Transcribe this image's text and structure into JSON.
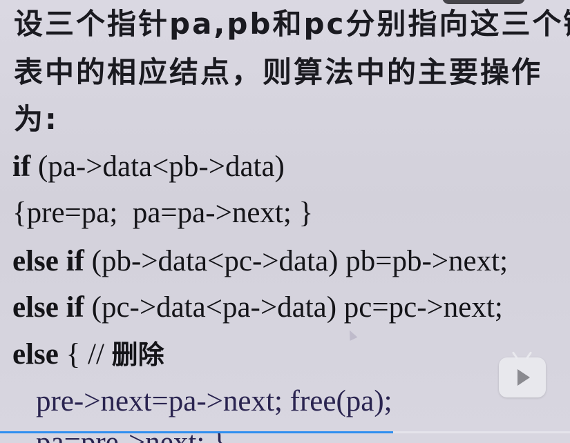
{
  "slide": {
    "intro_lines": [
      "设三个指针pa,pb和pc分别指向这三个链",
      "表中的相应结点，则算法中的主要操作",
      "为:"
    ],
    "code": [
      {
        "kw": "if",
        "rest": " (pa->data<pb->data)"
      },
      {
        "kw": "",
        "rest": "{pre=pa;  pa=pa->next; }"
      },
      {
        "kw": "else if",
        "rest": " (pb->data<pc->data) pb=pb->next;"
      },
      {
        "kw": "else if",
        "rest": " (pc->data<pa->data) pc=pc->next;"
      },
      {
        "kw": "else",
        "rest": " { // ",
        "comment": "删除"
      },
      {
        "kw": "",
        "rest": "pre->next=pa->next; free(pa);"
      },
      {
        "kw": "",
        "rest": "pa=pre->next; }"
      }
    ]
  },
  "player": {
    "progress_fraction": 0.69,
    "play_icon": "play-icon",
    "accent_color": "#2f8ff0"
  }
}
